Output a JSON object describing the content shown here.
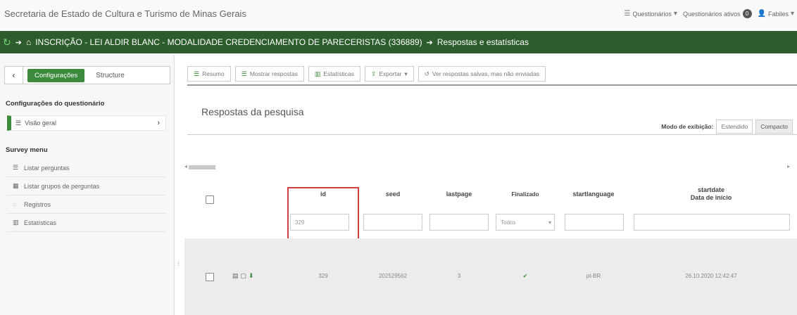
{
  "site": {
    "title": "Secretaria de Estado de Cultura e Turismo de Minas Gerais"
  },
  "topnav": {
    "questionnaires": "Questionários",
    "active_label": "Questionários ativos",
    "active_count": "0",
    "user": "Fabiles"
  },
  "breadcrumb": {
    "survey": "INSCRIÇÃO - LEI ALDIR BLANC - MODALIDADE CREDENCIAMENTO DE PARECERISTAS (336889)",
    "page": "Respostas e estatísticas"
  },
  "sidebar": {
    "tab_settings": "Configurações",
    "tab_structure": "Structure",
    "settings_title": "Configurações do questionário",
    "overview": "Visão geral",
    "survey_menu_title": "Survey menu",
    "items": [
      {
        "label": "Listar perguntas",
        "icon": "list-icon"
      },
      {
        "label": "Listar grupos de perguntas",
        "icon": "table-icon"
      },
      {
        "label": "Registros",
        "icon": "comment-icon"
      },
      {
        "label": "Estatísticas",
        "icon": "bar-chart-icon"
      }
    ]
  },
  "toolbar": {
    "summary": "Resumo",
    "show_responses": "Mostrar respostas",
    "statistics": "Estatísticas",
    "export": "Exportar",
    "saved": "Ver respostas salvas, mas não enviadas"
  },
  "main": {
    "title": "Respostas da pesquisa",
    "mode_label": "Modo de exibição:",
    "mode_extended": "Estendido",
    "mode_compact": "Compacto"
  },
  "table": {
    "headers": {
      "id": "id",
      "seed": "seed",
      "lastpage": "lastpage",
      "finalized": "Finalizado",
      "startlanguage": "startlanguage",
      "startdate_1": "startdate",
      "startdate_2": "Data de início"
    },
    "filters": {
      "id": "329",
      "finalized": "Todos"
    },
    "row": {
      "id": "329",
      "seed": "202529562",
      "lastpage": "3",
      "finalized": "✔",
      "startlanguage": "pt-BR",
      "startdate": "26.10.2020 12:42:47"
    }
  },
  "colors": {
    "brand_green": "#2d5d2d",
    "accent_green": "#3c8a3c",
    "highlight_red": "#d04040"
  }
}
